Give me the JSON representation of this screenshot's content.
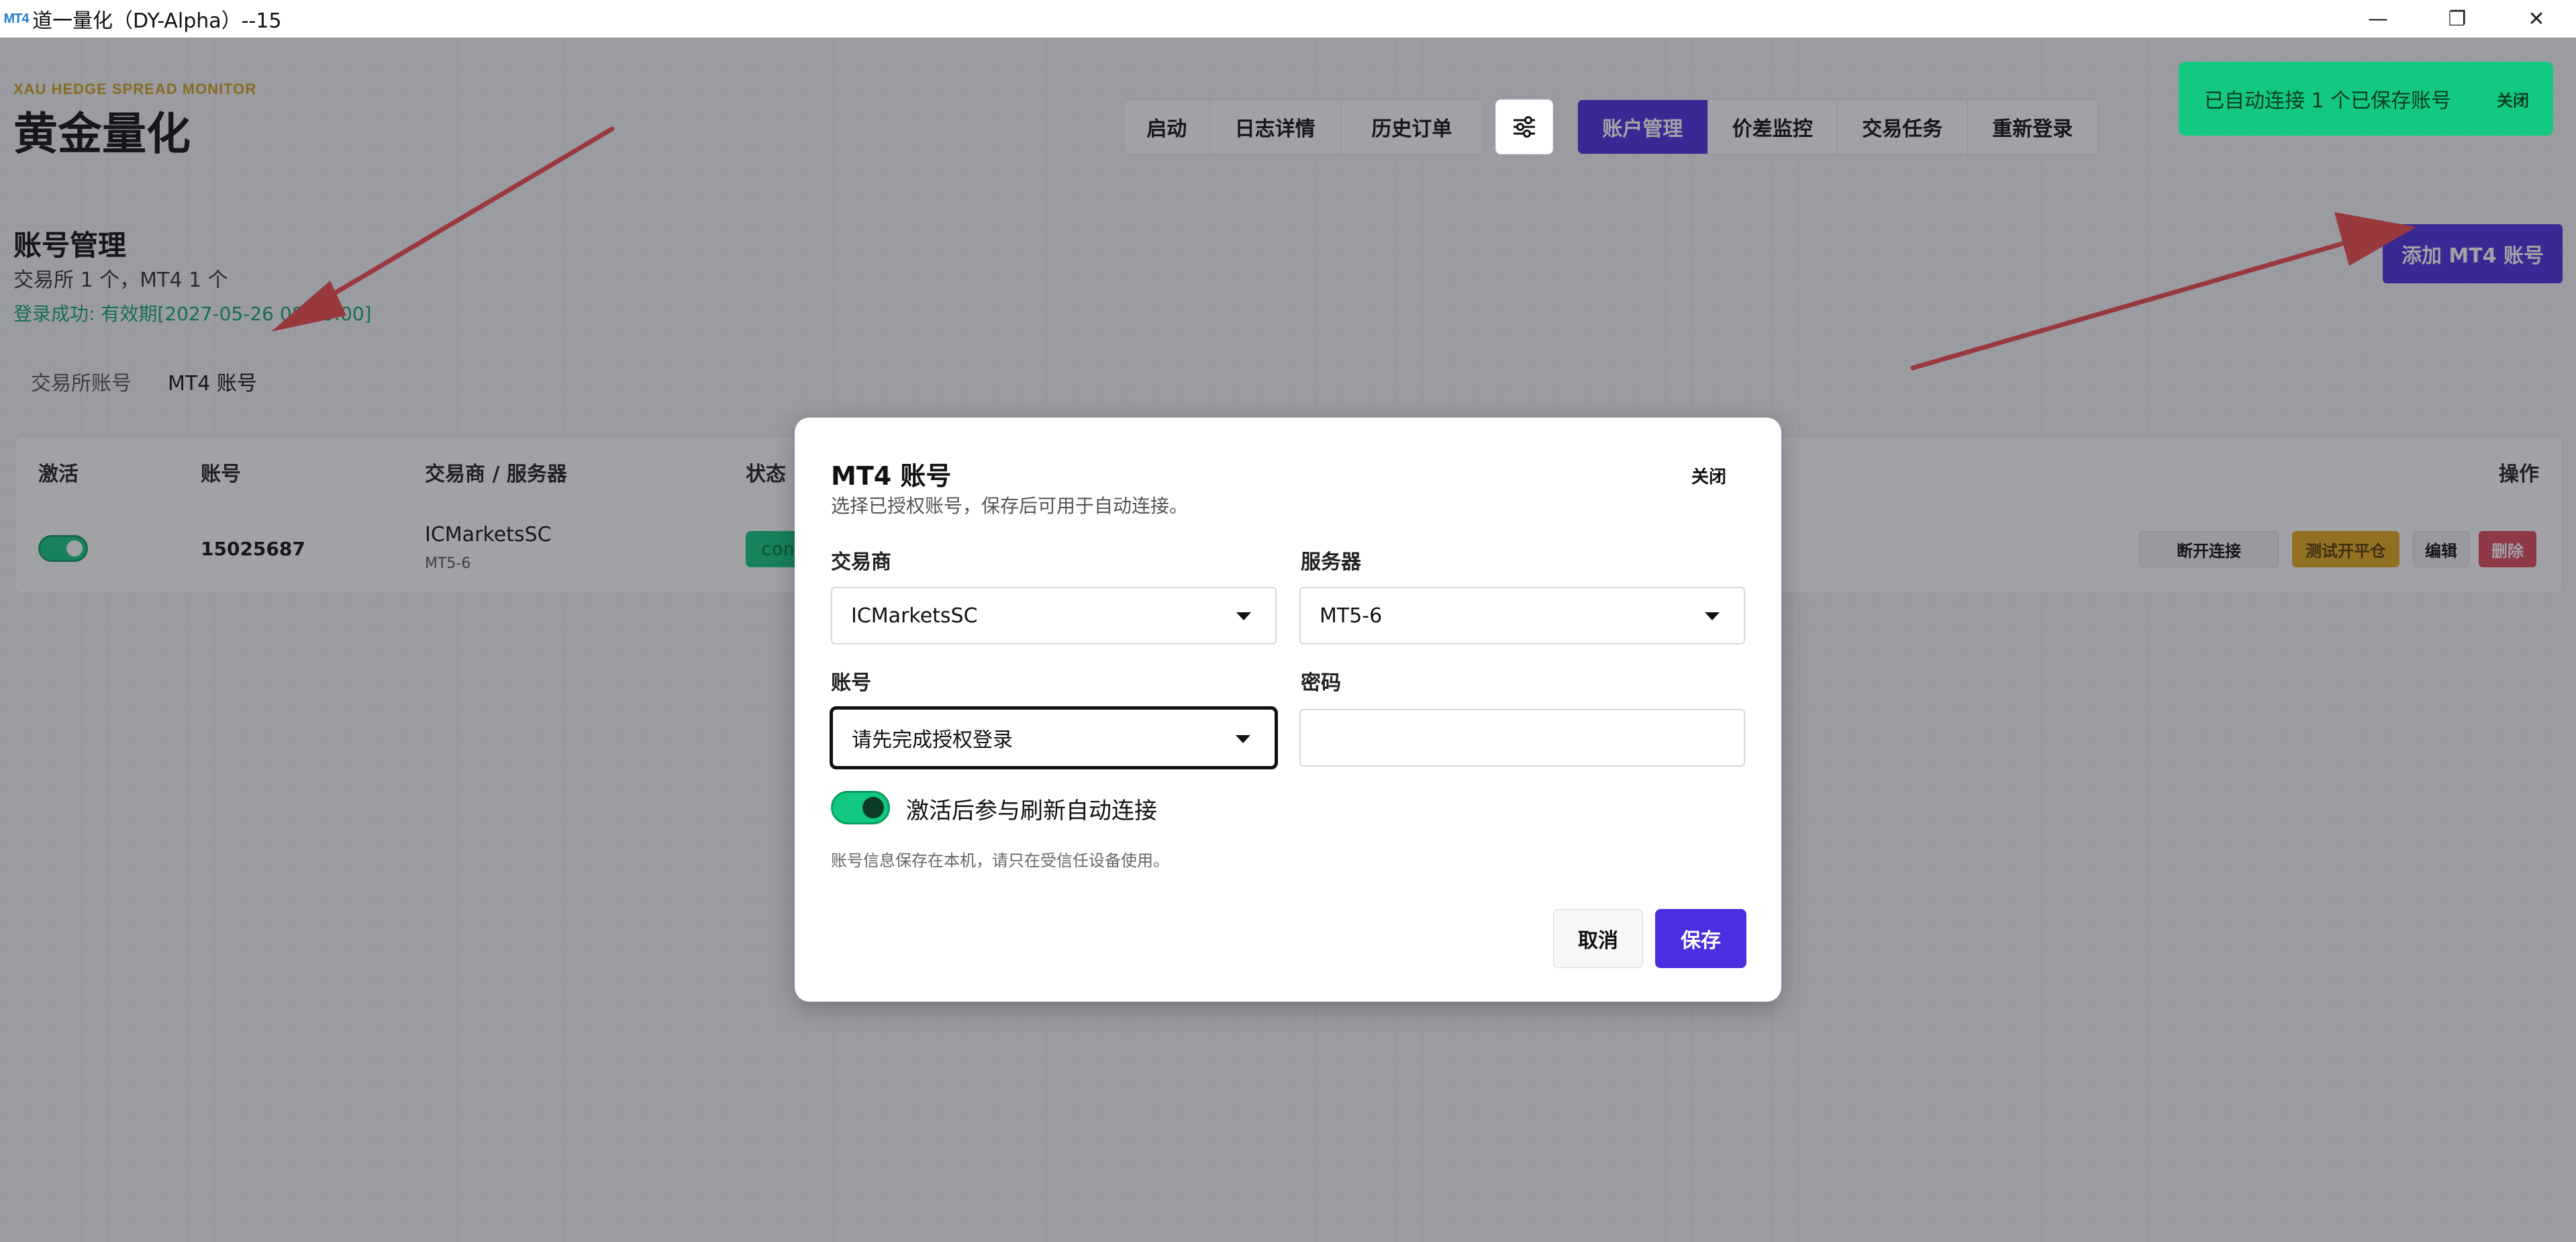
{
  "window": {
    "logo_text": "MT4",
    "title": "道一量化（DY-Alpha）--15",
    "minimize_glyph": "—",
    "maximize_glyph": "❐",
    "close_glyph": "✕"
  },
  "brand": {
    "subtitle": "XAU HEDGE SPREAD MONITOR",
    "title": "黄金量化"
  },
  "nav": {
    "left_group": [
      "启动",
      "日志详情",
      "历史订单"
    ],
    "filter_icon": "sliders-icon",
    "right_group": [
      "账户管理",
      "价差监控",
      "交易任务",
      "重新登录"
    ],
    "active": "账户管理"
  },
  "toast": {
    "text": "已自动连接 1 个已保存账号",
    "close_label": "关闭"
  },
  "page": {
    "title": "账号管理",
    "subtitle": "交易所 1 个，MT4 1 个",
    "login_status": "登录成功: 有效期[2027-05-26 08:00:00]",
    "add_button": "添加 MT4 账号",
    "subtabs": [
      "交易所账号",
      "MT4 账号"
    ],
    "active_subtab": "MT4 账号"
  },
  "table": {
    "headers": {
      "active": "激活",
      "account": "账号",
      "broker_server": "交易商 / 服务器",
      "status": "状态",
      "actions": "操作"
    },
    "row": {
      "active": true,
      "account": "15025687",
      "broker": "ICMarketsSC",
      "server": "MT5-6",
      "status": "connected",
      "buttons": {
        "disconnect": "断开连接",
        "test": "测试开平仓",
        "edit": "编辑",
        "delete": "删除"
      }
    }
  },
  "modal": {
    "title": "MT4 账号",
    "subtitle": "选择已授权账号，保存后可用于自动连接。",
    "close_label": "关闭",
    "broker_label": "交易商",
    "broker_value": "ICMarketsSC",
    "server_label": "服务器",
    "server_value": "MT5-6",
    "account_label": "账号",
    "account_value": "请先完成授权登录",
    "password_label": "密码",
    "password_value": "",
    "auto_connect_label": "激活后参与刷新自动连接",
    "auto_connect_enabled": true,
    "note": "账号信息保存在本机，请只在受信任设备使用。",
    "cancel_label": "取消",
    "save_label": "保存"
  },
  "colors": {
    "accent": "#4a2fe0",
    "success": "#12c97f",
    "warning": "#e3a91d",
    "danger": "#e0495b",
    "annotation_arrow": "#ef4b4b"
  }
}
